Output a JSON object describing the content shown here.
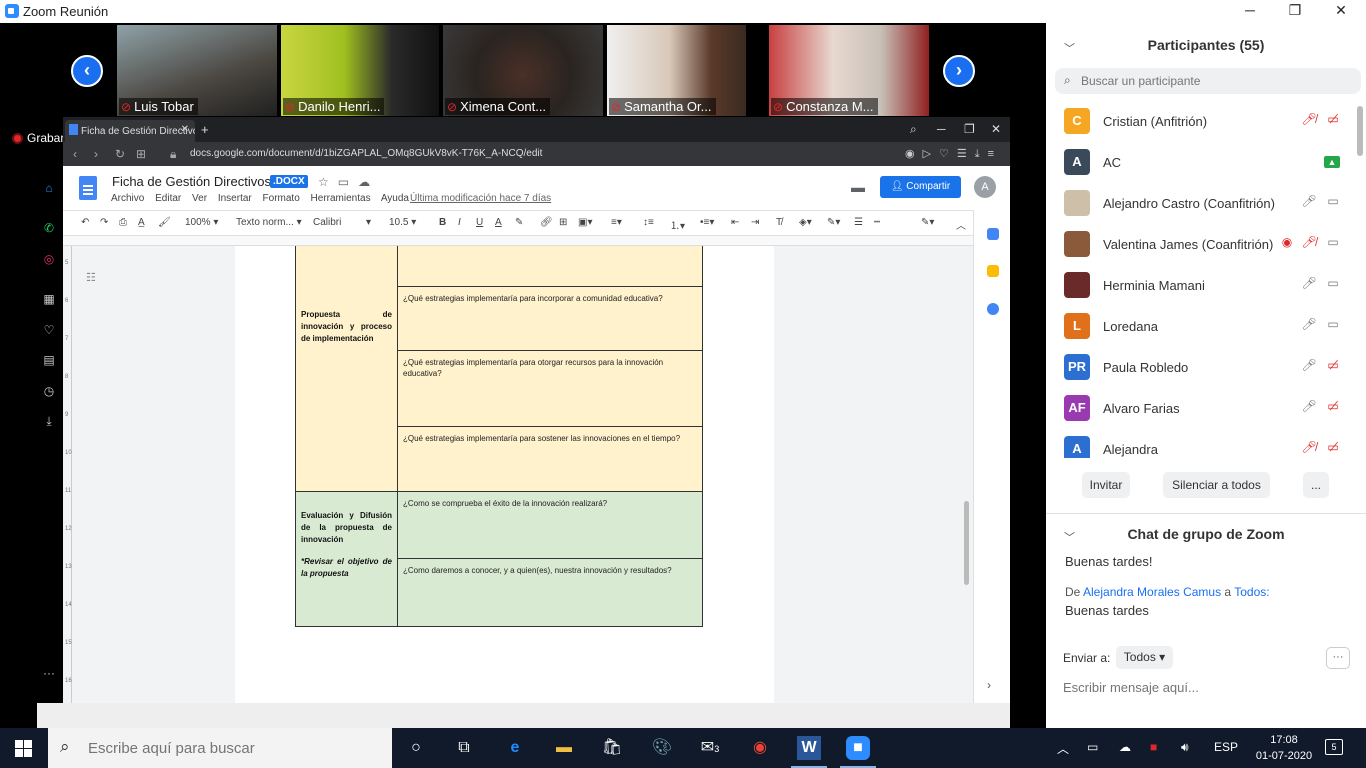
{
  "window": {
    "title": "Zoom Reunión"
  },
  "video_tiles": [
    {
      "name": "Luis Tobar"
    },
    {
      "name": "Danilo Henri..."
    },
    {
      "name": "Ximena Cont..."
    },
    {
      "name": "Samantha Or..."
    },
    {
      "name": "Constanza M..."
    }
  ],
  "recording": {
    "label": "Grabando"
  },
  "browser": {
    "tab_title": "Ficha de Gestión Directivos",
    "url": "docs.google.com/document/d/1biZGAPLAL_OMq8GUkV8vK-T76K_A-NCQ/edit"
  },
  "docs": {
    "title": "Ficha de Gestión Directivos",
    "badge": ".DOCX",
    "menus": [
      "Archivo",
      "Editar",
      "Ver",
      "Insertar",
      "Formato",
      "Herramientas",
      "Ayuda"
    ],
    "last_modified": "Última modificación hace 7 días",
    "share_label": "Compartir",
    "avatar_letter": "A",
    "toolbar": {
      "zoom": "100%",
      "style": "Texto norm...",
      "font": "Calibri",
      "size": "10.5"
    },
    "table": {
      "section1_title": "Propuesta de innovación y proceso de implementación",
      "section1_questions": [
        "¿Qué estrategias implementaría para incorporar a comunidad educativa?",
        "¿Qué estrategias implementaría para otorgar recursos para la innovación educativa?",
        "¿Qué estrategias implementaría para sostener las innovaciones en el tiempo?"
      ],
      "section2_title": "Evaluación y Difusión de la propuesta de innovación",
      "section2_note": "*Revisar el objetivo de la propuesta",
      "section2_questions": [
        "¿Como se comprueba el éxito de la innovación realizará?",
        "¿Como daremos a conocer, y a quien(es), nuestra innovación y resultados?"
      ]
    }
  },
  "participants": {
    "header": "Participantes (55)",
    "search_placeholder": "Buscar un participante",
    "list": [
      {
        "name": "Cristian (Anfitrión)",
        "initials": "C",
        "color": "#f5a623"
      },
      {
        "name": "AC",
        "initials": "A",
        "color": "#3a4a5a"
      },
      {
        "name": "Alejandro Castro (Coanfitrión)",
        "initials": "",
        "color": "#cdbfa8"
      },
      {
        "name": "Valentina James (Coanfitrión)",
        "initials": "",
        "color": "#8a5a3a"
      },
      {
        "name": "Herminia Mamani",
        "initials": "",
        "color": "#6a2a2a"
      },
      {
        "name": "Loredana",
        "initials": "L",
        "color": "#e0711a"
      },
      {
        "name": "Paula Robledo",
        "initials": "PR",
        "color": "#2d6fd0"
      },
      {
        "name": "Alvaro Farias",
        "initials": "AF",
        "color": "#9a3ab0"
      },
      {
        "name": "Alejandra",
        "initials": "A",
        "color": "#2d6fd0"
      }
    ],
    "invite_label": "Invitar",
    "mute_all_label": "Silenciar a todos",
    "more_label": "..."
  },
  "chat": {
    "header": "Chat de grupo de Zoom",
    "messages": [
      {
        "text": "Buenas tardes!"
      },
      {
        "from_prefix": "De",
        "from": "Alejandra Morales Camus",
        "to_prefix": "a",
        "to": "Todos:",
        "text": "Buenas tardes"
      }
    ],
    "send_to_label": "Enviar a:",
    "send_to_value": "Todos",
    "input_placeholder": "Escribir mensaje aquí..."
  },
  "taskbar": {
    "search_placeholder": "Escribe aquí para buscar",
    "language": "ESP",
    "time": "17:08",
    "date": "01-07-2020",
    "notification_count": "5",
    "mail_badge": "3"
  }
}
